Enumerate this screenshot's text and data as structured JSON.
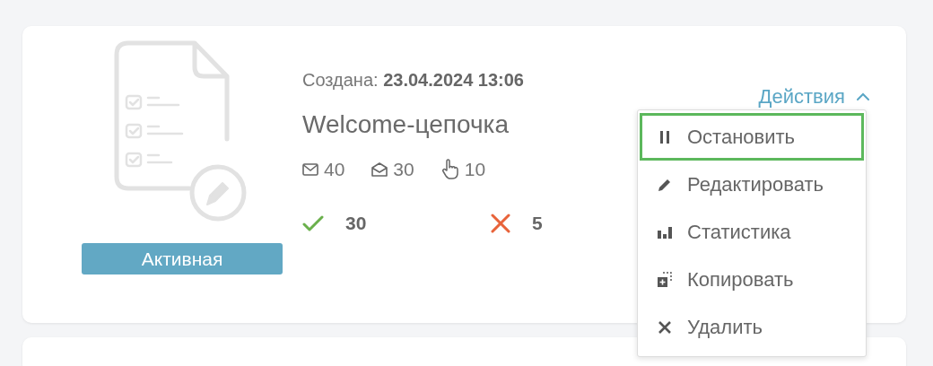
{
  "card": {
    "status": {
      "label": "Активная",
      "kind": "active"
    },
    "created": {
      "label": "Создана:",
      "value": "23.04.2024 13:06"
    },
    "title": "Welcome-цепочка",
    "stats": [
      {
        "kind": "sent",
        "value": "40"
      },
      {
        "kind": "opened",
        "value": "30"
      },
      {
        "kind": "clicked",
        "value": "10"
      }
    ],
    "results": [
      {
        "kind": "success",
        "value": "30"
      },
      {
        "kind": "failure",
        "value": "5"
      }
    ],
    "actions": {
      "label": "Действия",
      "expanded": true,
      "items": [
        {
          "kind": "pause",
          "label": "Остановить",
          "selected": true
        },
        {
          "kind": "edit",
          "label": "Редактировать",
          "selected": false
        },
        {
          "kind": "stats",
          "label": "Статистика",
          "selected": false
        },
        {
          "kind": "copy",
          "label": "Копировать",
          "selected": false
        },
        {
          "kind": "delete",
          "label": "Удалить",
          "selected": false
        }
      ]
    }
  }
}
